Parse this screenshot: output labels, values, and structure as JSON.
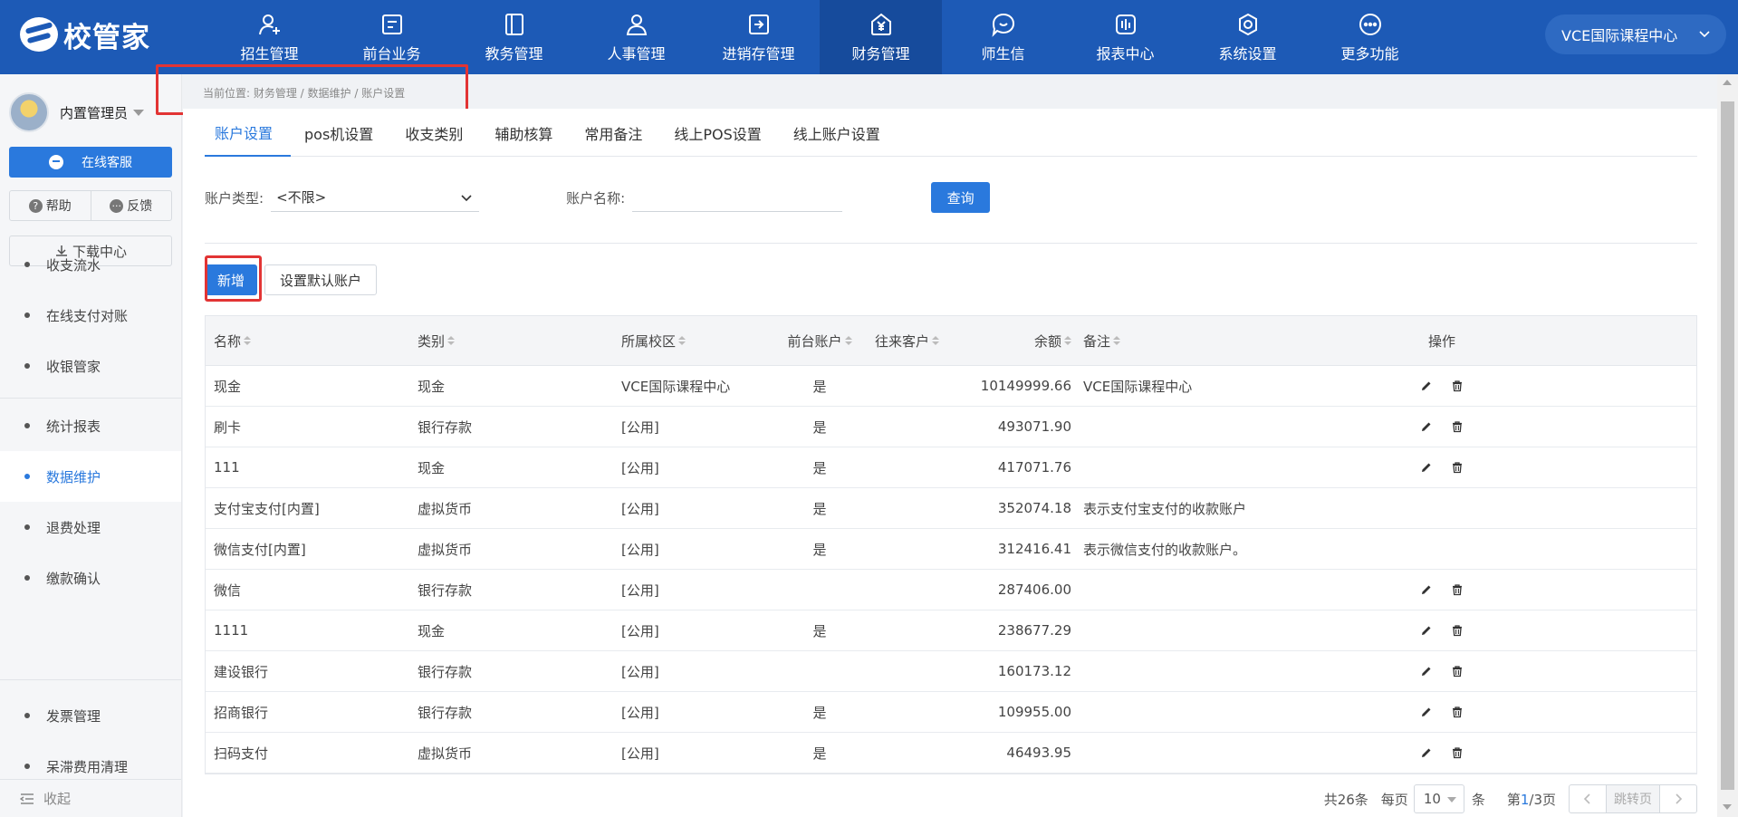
{
  "app": {
    "logo_text": "校管家"
  },
  "nav": [
    {
      "label": "招生管理",
      "icon": "add-user-icon"
    },
    {
      "label": "前台业务",
      "icon": "desk-icon"
    },
    {
      "label": "教务管理",
      "icon": "book-icon"
    },
    {
      "label": "人事管理",
      "icon": "person-icon"
    },
    {
      "label": "进销存管理",
      "icon": "inventory-icon"
    },
    {
      "label": "财务管理",
      "icon": "finance-icon",
      "active": true
    },
    {
      "label": "师生信",
      "icon": "chat-icon"
    },
    {
      "label": "报表中心",
      "icon": "report-icon"
    },
    {
      "label": "系统设置",
      "icon": "settings-icon"
    },
    {
      "label": "更多功能",
      "icon": "more-icon"
    }
  ],
  "campus": "VCE国际课程中心",
  "sidebar": {
    "user_name": "内置管理员",
    "service_label": "在线客服",
    "help_label": "帮助",
    "feedback_label": "反馈",
    "download_label": "下载中心",
    "group1": [
      "收支流水",
      "在线支付对账",
      "收银管家"
    ],
    "group2": [
      "统计报表",
      "数据维护",
      "退费处理",
      "缴款确认"
    ],
    "group3": [
      "发票管理",
      "呆滞费用清理"
    ],
    "active_item": "数据维护",
    "collapse_label": "收起"
  },
  "breadcrumb": "当前位置: 财务管理 / 数据维护 / 账户设置",
  "tabs": [
    "账户设置",
    "pos机设置",
    "收支类别",
    "辅助核算",
    "常用备注",
    "线上POS设置",
    "线上账户设置"
  ],
  "filter": {
    "type_label": "账户类型:",
    "type_value": "<不限>",
    "name_label": "账户名称:",
    "name_value": "",
    "query_label": "查询"
  },
  "actions": {
    "add_label": "新增",
    "default_label": "设置默认账户"
  },
  "table": {
    "headers": [
      "名称",
      "类别",
      "所属校区",
      "前台账户",
      "往来客户",
      "余额",
      "备注",
      "操作"
    ],
    "rows": [
      {
        "name": "现金",
        "category": "现金",
        "campus": "VCE国际课程中心",
        "front": "是",
        "client": "",
        "balance": "10149999.66",
        "note": "VCE国际课程中心",
        "ops": true
      },
      {
        "name": "刷卡",
        "category": "银行存款",
        "campus": "[公用]",
        "front": "是",
        "client": "",
        "balance": "493071.90",
        "note": "",
        "ops": true
      },
      {
        "name": "111",
        "category": "现金",
        "campus": "[公用]",
        "front": "是",
        "client": "",
        "balance": "417071.76",
        "note": "",
        "ops": true
      },
      {
        "name": "支付宝支付[内置]",
        "category": "虚拟货币",
        "campus": "[公用]",
        "front": "是",
        "client": "",
        "balance": "352074.18",
        "note": "表示支付宝支付的收款账户",
        "ops": false
      },
      {
        "name": "微信支付[内置]",
        "category": "虚拟货币",
        "campus": "[公用]",
        "front": "是",
        "client": "",
        "balance": "312416.41",
        "note": "表示微信支付的收款账户。",
        "ops": false
      },
      {
        "name": "微信",
        "category": "银行存款",
        "campus": "[公用]",
        "front": "",
        "client": "",
        "balance": "287406.00",
        "note": "",
        "ops": true
      },
      {
        "name": "1111",
        "category": "现金",
        "campus": "[公用]",
        "front": "是",
        "client": "",
        "balance": "238677.29",
        "note": "",
        "ops": true
      },
      {
        "name": "建设银行",
        "category": "银行存款",
        "campus": "[公用]",
        "front": "",
        "client": "",
        "balance": "160173.12",
        "note": "",
        "ops": true
      },
      {
        "name": "招商银行",
        "category": "银行存款",
        "campus": "[公用]",
        "front": "是",
        "client": "",
        "balance": "109955.00",
        "note": "",
        "ops": true
      },
      {
        "name": "扫码支付",
        "category": "虚拟货币",
        "campus": "[公用]",
        "front": "是",
        "client": "",
        "balance": "46493.95",
        "note": "",
        "ops": true
      }
    ]
  },
  "pager": {
    "total": "共26条",
    "per_page_label": "每页",
    "per_page": "10",
    "unit": "条",
    "page_prefix": "第",
    "page_current": "1",
    "page_suffix": "/3页",
    "jump_label": "跳转页"
  },
  "colors": {
    "primary": "#1d5ab6",
    "accent": "#2a79dd",
    "highlight": "#e23434"
  }
}
